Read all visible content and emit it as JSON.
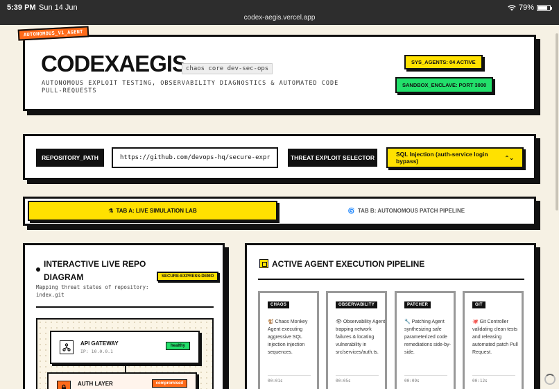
{
  "status_bar": {
    "time": "5:39 PM",
    "date": "Sun 14 Jun",
    "url": "codex-aegis.vercel.app",
    "battery": "79%",
    "battery_level": 0.79
  },
  "hero": {
    "corner_tag": "AUTONOMOUS_V1_AGENT",
    "title": "CODEXAEGIS",
    "subtitle_tag": "chaos core dev-sec-ops",
    "tagline": "AUTONOMOUS EXPLOIT TESTING, OBSERVABILITY DIAGNOSTICS & AUTOMATED CODE PULL-REQUESTS",
    "badge_agents": "SYS_AGENTS: 04 ACTIVE",
    "badge_sandbox": "SANDBOX_ENCLAVE: PORT 3000",
    "colors": {
      "yellow": "#ffe100",
      "green": "#22e06b",
      "orange": "#ff6b1a"
    }
  },
  "config": {
    "repo_label": "REPOSITORY_PATH",
    "repo_value": "https://github.com/devops-hq/secure-express-demo",
    "threat_label": "THREAT EXPLOIT SELECTOR",
    "threat_selected": "SQL Injection (auth-service login bypass)"
  },
  "tabs": [
    {
      "icon": "flask-icon",
      "glyph": "⚗",
      "label": "TAB A: LIVE SIMULATION LAB",
      "active": true
    },
    {
      "icon": "cycle-icon",
      "glyph": "🌀",
      "label": "TAB B: AUTONOMOUS PATCH PIPELINE",
      "active": false
    }
  ],
  "repo_panel": {
    "title_line1": "INTERACTIVE LIVE REPO",
    "title_line2": "DIAGRAM",
    "badge": "SECURE-EXPRESS-DEMO",
    "description": "Mapping threat states of repository: index.git",
    "nodes": [
      {
        "name": "API GATEWAY",
        "ip": "IP: 10.0.0.1",
        "status": "healthy",
        "icon": "network-icon"
      },
      {
        "name": "AUTH LAYER",
        "ip": "",
        "status": "compromised",
        "icon": "lock-icon"
      }
    ]
  },
  "pipeline_panel": {
    "title": "ACTIVE AGENT EXECUTION PIPELINE",
    "agents": [
      {
        "label": "CHAOS",
        "icon": "monkey-icon",
        "glyph": "🐒",
        "description": "Chaos Monkey Agent executing aggressive SQL injection injection sequences.",
        "time": "00:01s"
      },
      {
        "label": "OBSERVABILITY",
        "icon": "eye-icon",
        "glyph": "👁",
        "description": "Observability Agent trapping network failures & locating vulnerability in src/services/auth.ts.",
        "time": "00:05s"
      },
      {
        "label": "PATCHER",
        "icon": "wrench-icon",
        "glyph": "🔧",
        "description": "Patching Agent synthesizing safe parameterized code remediations side-by-side.",
        "time": "00:09s"
      },
      {
        "label": "GIT",
        "icon": "git-icon",
        "glyph": "🐙",
        "description": "Git Controller validating clean tests and releasing automated patch Pull Request.",
        "time": "00:12s"
      }
    ]
  }
}
